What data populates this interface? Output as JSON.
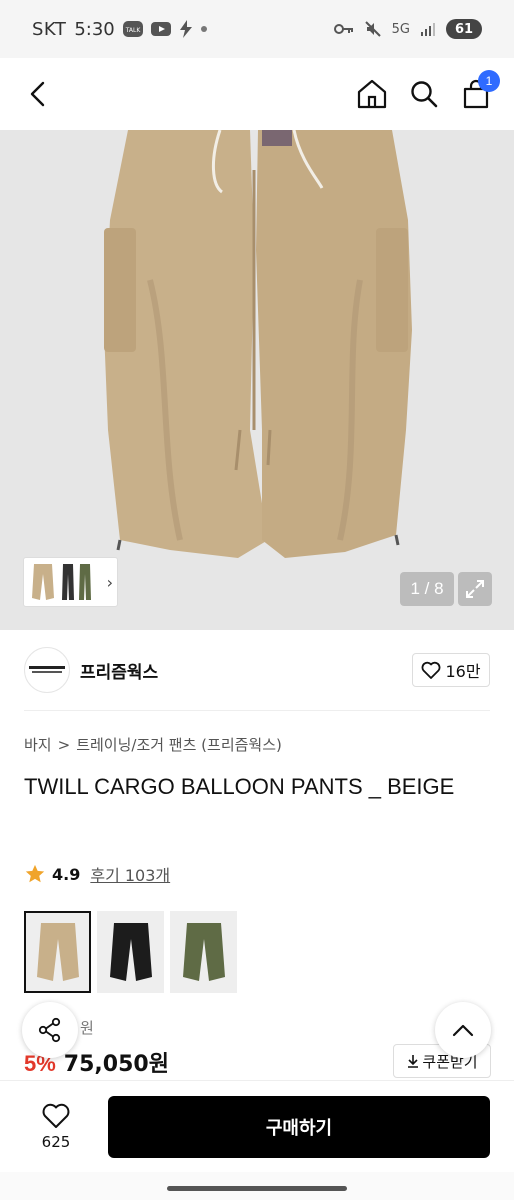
{
  "status_bar": {
    "carrier": "SKT",
    "time": "5:30",
    "network": "5G",
    "battery": "61"
  },
  "header": {
    "cart_count": "1"
  },
  "gallery": {
    "page_indicator": "1 / 8"
  },
  "brand": {
    "name": "프리즘웍스",
    "likes": "16만"
  },
  "breadcrumb": {
    "category": "바지",
    "separator": ">",
    "subcategory": "트레이닝/조거 팬츠 (프리즘웍스)"
  },
  "product": {
    "title": "TWILL CARGO BALLOON PANTS _ BEIGE",
    "rating": "4.9",
    "reviews": "후기 103개",
    "colors": [
      {
        "name": "beige",
        "hex": "#c8b08a"
      },
      {
        "name": "black",
        "hex": "#1c1c1c"
      },
      {
        "name": "olive",
        "hex": "#5f6b45"
      }
    ],
    "price_label_partial": "원",
    "discount": "5%",
    "price": "75,050원",
    "coupon_label": "쿠폰받기"
  },
  "bottom_bar": {
    "like_count": "625",
    "buy_label": "구매하기"
  },
  "colors": {
    "accent": "#2f6bff",
    "discount": "#e2382a",
    "star": "#f0a42b",
    "product_beige": "#c8b08a"
  }
}
